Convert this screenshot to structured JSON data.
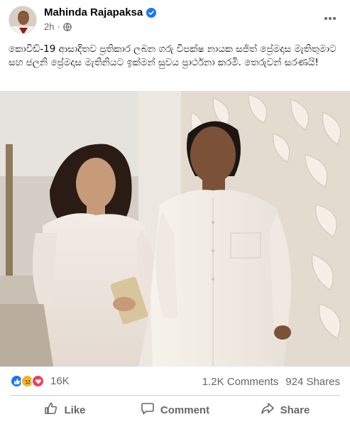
{
  "post": {
    "author": "Mahinda Rajapaksa",
    "time": "2h",
    "text": "කොවිඩ්-19 ආසාදිතව ප්‍රතිකාර ලබන ගරු විපක්ෂ නායක සජිත් ප්‍රේමදාස මැතිතුමාට සහ ජලනි ප්‍රේමදාස මැතිනියට ඉක්මන් සුවය ප්‍රාර්ථනා කරමි. තෙරුවන් සරණයි!"
  },
  "icons": {
    "verified": "verified-badge-icon",
    "privacy": "globe-icon",
    "more": "more-options-icon",
    "like_reaction": "like-reaction-icon",
    "sad_reaction": "sad-reaction-icon",
    "love_reaction": "love-reaction-icon",
    "like": "thumbs-up-icon",
    "comment": "comment-icon",
    "share": "share-icon"
  },
  "stats": {
    "reactions_count": "16K",
    "comments": "1.2K Comments",
    "shares": "924 Shares"
  },
  "actions": {
    "like": "Like",
    "comment": "Comment",
    "share": "Share"
  },
  "colors": {
    "brand": "#1877f2",
    "muted": "#65676b",
    "love": "#f33e58",
    "sad": "#f7b125"
  }
}
